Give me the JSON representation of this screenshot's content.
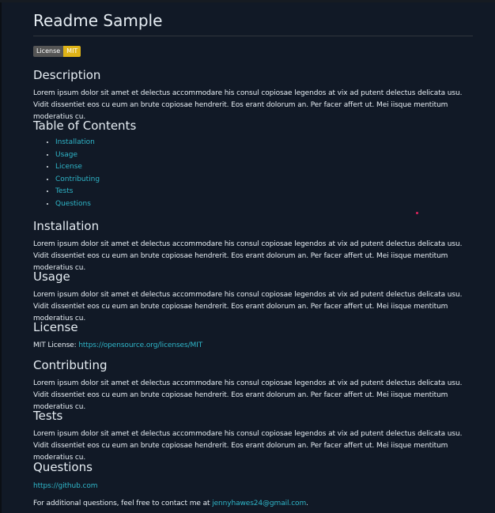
{
  "title": "Readme Sample",
  "badge": {
    "label": "License",
    "value": "MIT"
  },
  "lorem": "Lorem ipsum dolor sit amet et delectus accommodare his consul copiosae legendos at vix ad putent delectus delicata usu. Vidit dissentiet eos cu eum an brute copiosae hendrerit. Eos erant dolorum an. Per facer affert ut. Mei iisque mentitum moderatius cu.",
  "sections": {
    "description": {
      "heading": "Description"
    },
    "toc": {
      "heading": "Table of Contents",
      "items": [
        "Installation",
        "Usage",
        "License",
        "Contributing",
        "Tests",
        "Questions"
      ]
    },
    "installation": {
      "heading": "Installation"
    },
    "usage": {
      "heading": "Usage"
    },
    "license": {
      "heading": "License",
      "prefix": "MIT License: ",
      "link": "https://opensource.org/licenses/MIT"
    },
    "contributing": {
      "heading": "Contributing"
    },
    "tests": {
      "heading": "Tests"
    },
    "questions": {
      "heading": "Questions",
      "github": "https://github.com",
      "contact_prefix": "For additional questions, feel free to contact me at ",
      "email": "jennyhawes24@gmail.com",
      "contact_suffix": "."
    }
  },
  "colors": {
    "background": "#111926",
    "link": "#2fb6c9",
    "badge_left": "#555555",
    "badge_right": "#dfb317"
  }
}
